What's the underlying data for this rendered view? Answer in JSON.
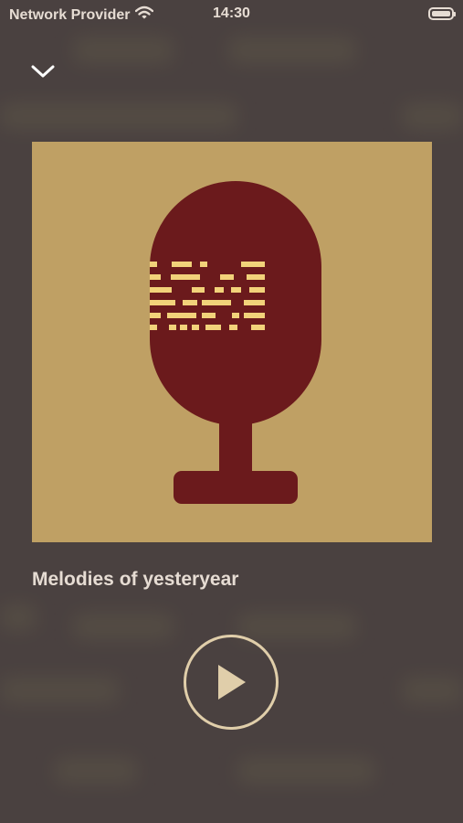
{
  "status_bar": {
    "carrier": "Network Provider",
    "time": "14:30",
    "wifi_icon": "wifi-icon",
    "battery_icon": "battery-icon"
  },
  "player": {
    "collapse_icon": "chevron-down-icon",
    "artwork": "microphone-artwork",
    "title": "Melodies of yesteryear",
    "play_icon": "play-icon"
  },
  "colors": {
    "background": "#4a4140",
    "artwork_background": "#bfa064",
    "microphone": "#6b1a1c",
    "microphone_stripes": "#f2d27a",
    "text": "#e6dcd3",
    "play_ring": "#e0ceaa"
  }
}
